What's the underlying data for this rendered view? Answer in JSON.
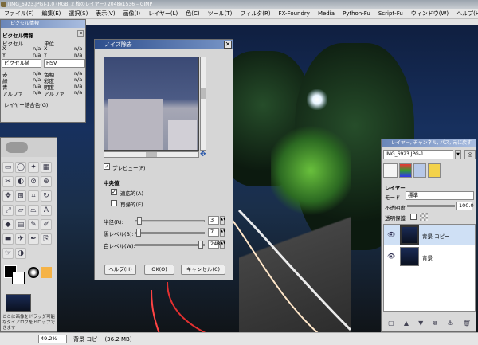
{
  "window": {
    "title": "[IMG_6923.JPG]-1.0 (RGB, 2 枚のレイヤー) 2048x1536 – GIMP"
  },
  "menu": [
    "ファイル(F)",
    "編集(E)",
    "選択(S)",
    "表示(V)",
    "画像(I)",
    "レイヤー(L)",
    "色(C)",
    "ツール(T)",
    "フィルタ(R)",
    "FX-Foundry",
    "Media",
    "Python-Fu",
    "Script-Fu",
    "ウィンドウ(W)",
    "ヘルプ(H)"
  ],
  "pointer_panel": {
    "title": "ピクセル情報",
    "header": "ピクセル情報",
    "col1": "ピクセル",
    "col2": "単位",
    "x_label": "X",
    "y_label": "Y",
    "na": "n/a",
    "mode_left": "ピクセル値",
    "mode_right": "HSV",
    "labels_left": [
      "赤",
      "緑",
      "青",
      "アルファ"
    ],
    "labels_right": [
      "色相",
      "彩度",
      "明度",
      "アルファ"
    ],
    "sample": "レイヤー結合色(G)"
  },
  "toolbox": {
    "tools": [
      "rect-select",
      "ellipse-select",
      "lasso",
      "fuzzy-select",
      "by-color",
      "scissors",
      "foreground",
      "paths",
      "color-picker",
      "zoom",
      "measure",
      "move",
      "align",
      "crop",
      "rotate",
      "scale",
      "shear",
      "perspective",
      "flip",
      "text",
      "bucket",
      "blend",
      "pencil",
      "brush",
      "eraser",
      "airbrush",
      "ink",
      "clone",
      "heal",
      "perspective-clone",
      "blur",
      "smudge",
      "dodge"
    ],
    "hint": "ここに画像をドラッグ可能なダイアログをドロップできます"
  },
  "dialog": {
    "title": "ノイズ除去",
    "preview_label": "プレビュー(P)",
    "preview_checked": true,
    "section": "中央値",
    "adaptive_label": "適応的(A)",
    "adaptive_checked": true,
    "recursive_label": "再帰的(E)",
    "recursive_checked": false,
    "params": [
      {
        "label": "半径(R):",
        "value": "3",
        "pos": 0.05
      },
      {
        "label": "黒レベル(B):",
        "value": "7",
        "pos": 0.03
      },
      {
        "label": "白レベル(W):",
        "value": "248",
        "pos": 0.97
      }
    ],
    "buttons": [
      "ヘルプ(H)",
      "OK(O)",
      "キャンセル(C)"
    ]
  },
  "layers_panel": {
    "title": "レイヤー, チャンネル, パス, 元に戻す",
    "image_select": "IMG_6923.JPG-1",
    "section": "レイヤー",
    "mode_label": "モード",
    "mode_value": "標準",
    "opacity_label": "不透明度",
    "opacity_value": "100.0",
    "lock_label": "透明保護",
    "layers": [
      {
        "name": "背景 コピー",
        "selected": true
      },
      {
        "name": "背景",
        "selected": false
      }
    ]
  },
  "status": {
    "zoom": "49.2%",
    "info": "背景 コピー (36.2 MB)"
  }
}
